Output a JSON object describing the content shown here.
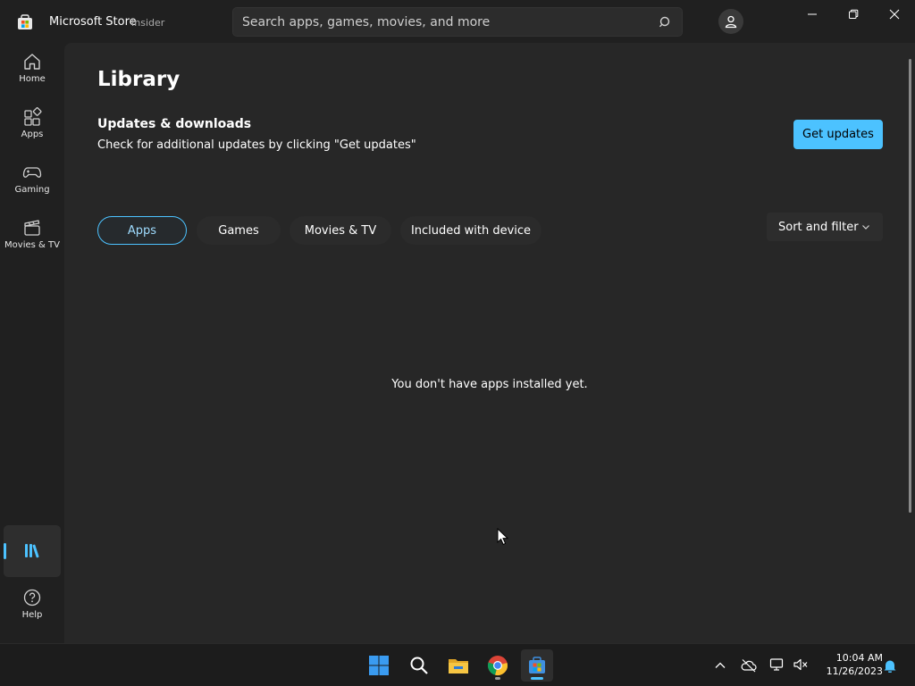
{
  "app": {
    "title": "Microsoft Store",
    "badge": "Insider"
  },
  "search": {
    "placeholder": "Search apps, games, movies, and more"
  },
  "nav": {
    "items": [
      {
        "label": "Home",
        "icon": "home-icon"
      },
      {
        "label": "Apps",
        "icon": "apps-icon"
      },
      {
        "label": "Gaming",
        "icon": "gamepad-icon"
      },
      {
        "label": "Movies & TV",
        "icon": "clapperboard-icon"
      }
    ],
    "library_icon": "library-icon",
    "help": {
      "label": "Help",
      "icon": "help-icon"
    }
  },
  "main": {
    "title": "Library",
    "updates": {
      "heading": "Updates & downloads",
      "description": "Check for additional updates by clicking \"Get updates\"",
      "button": "Get updates"
    },
    "tabs": [
      {
        "label": "Apps",
        "selected": true
      },
      {
        "label": "Games",
        "selected": false
      },
      {
        "label": "Movies & TV",
        "selected": false
      },
      {
        "label": "Included with device",
        "selected": false
      }
    ],
    "sort_filter": "Sort and filter",
    "empty_message": "You don't have apps installed yet."
  },
  "taskbar": {
    "time": "10:04 AM",
    "date": "11/26/2023"
  },
  "colors": {
    "accent": "#4cc2ff",
    "background": "#202020",
    "content": "#272727"
  }
}
